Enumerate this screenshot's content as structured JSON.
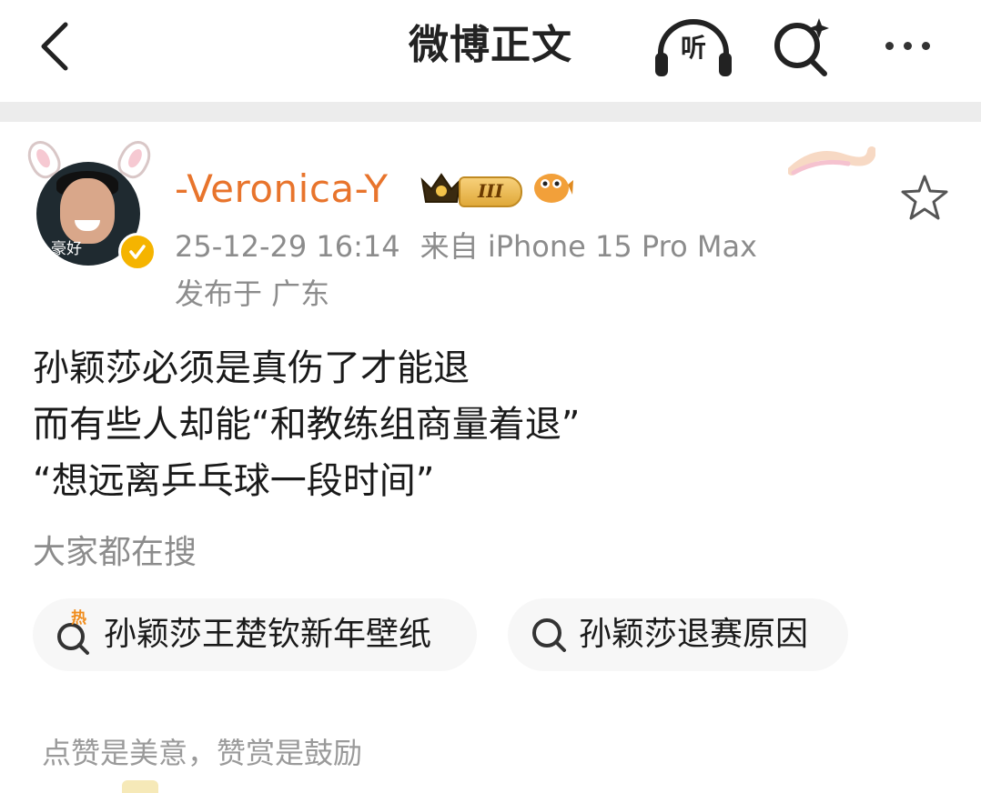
{
  "header": {
    "title": "微博正文",
    "listen_label": "听"
  },
  "post": {
    "username": "-Veronica-Y",
    "avatar_caption": "豪好",
    "level_badge": "III",
    "timestamp": "25-12-29 16:14",
    "source": "来自 iPhone 15 Pro Max",
    "location": "发布于 广东",
    "body_lines": [
      "孙颖莎必须是真伤了才能退",
      "而有些人却能“和教练组商量着退”",
      "“想远离乒乓球一段时间”"
    ]
  },
  "trending": {
    "label": "大家都在搜",
    "hot_mark": "热",
    "items": [
      {
        "text": "孙颖莎王楚钦新年壁纸",
        "icon": "hot-search-icon"
      },
      {
        "text": "孙颖莎退赛原因",
        "icon": "search-icon"
      }
    ]
  },
  "reward": {
    "text": "点赞是美意，赞赏是鼓励"
  },
  "colors": {
    "username": "#e8742c",
    "meta": "#8c8c8c",
    "verified": "#f5b400",
    "hot": "#f08c1b"
  }
}
